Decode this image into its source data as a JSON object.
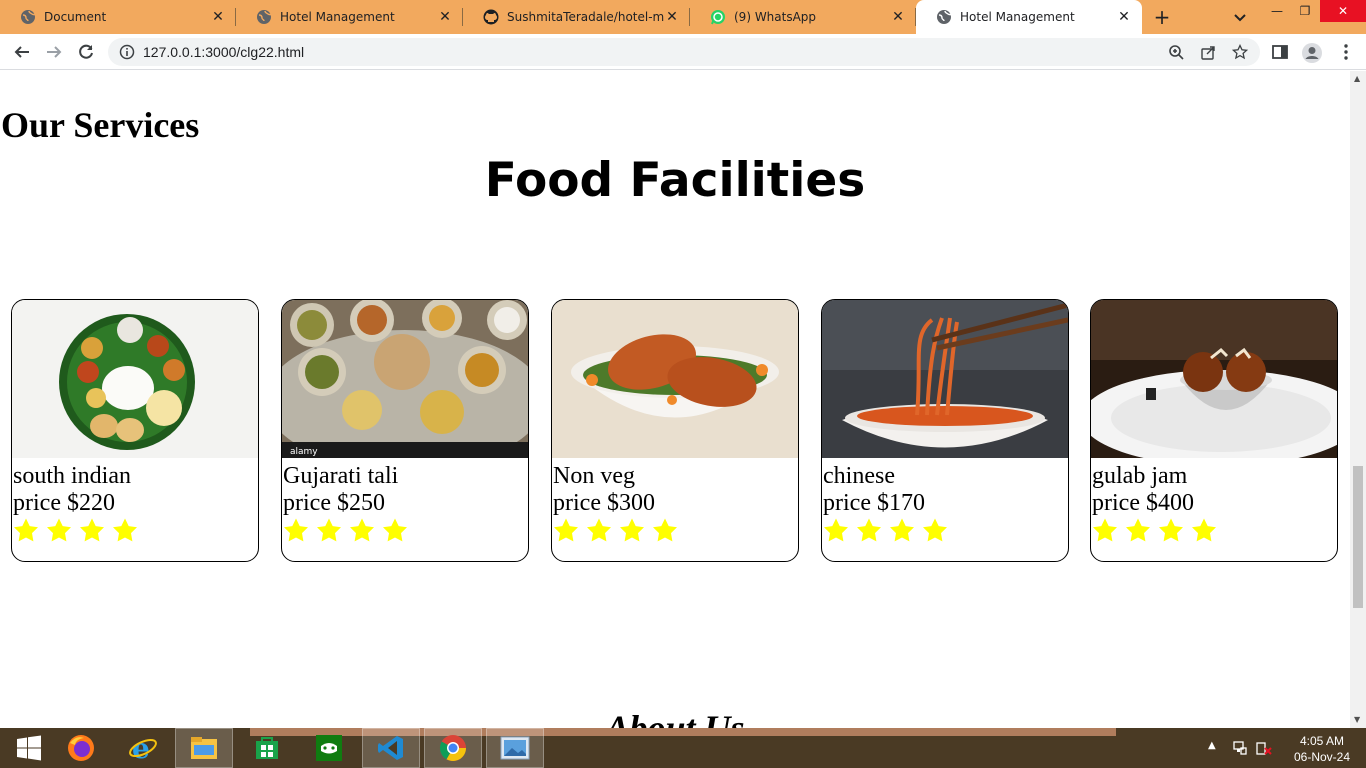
{
  "browser": {
    "tabs": [
      {
        "label": "Document",
        "icon": "globe-icon",
        "active": false
      },
      {
        "label": "Hotel Management",
        "icon": "globe-icon",
        "active": false
      },
      {
        "label": "SushmitaTeradale/hotel-mana",
        "icon": "github-icon",
        "active": false
      },
      {
        "label": "(9) WhatsApp",
        "icon": "whatsapp-icon",
        "active": false
      },
      {
        "label": "Hotel Management",
        "icon": "globe-icon",
        "active": true
      }
    ],
    "new_tab_label": "+",
    "address": "127.0.0.1:3000/clg22.html",
    "tab_strip_color": "#f2a95e"
  },
  "page": {
    "services_title": "Our Services",
    "food_title": "Food Facilities",
    "about_title": "About Us",
    "star_color": "#ffff00",
    "food_items": [
      {
        "name": "south indian",
        "price": "price $220",
        "rating": 4
      },
      {
        "name": "Gujarati tali",
        "price": "price $250",
        "rating": 4
      },
      {
        "name": "Non veg",
        "price": "price $300",
        "rating": 4
      },
      {
        "name": "chinese",
        "price": "price $170",
        "rating": 4
      },
      {
        "name": "gulab jam",
        "price": "price $400",
        "rating": 4
      }
    ]
  },
  "taskbar": {
    "apps": [
      "windows-start-icon",
      "firefox-icon",
      "internet-explorer-icon",
      "file-explorer-icon",
      "store-icon",
      "xbox-icon",
      "vscode-icon",
      "chrome-icon",
      "photos-icon"
    ],
    "time": "4:05 AM",
    "date": "06-Nov-24"
  }
}
